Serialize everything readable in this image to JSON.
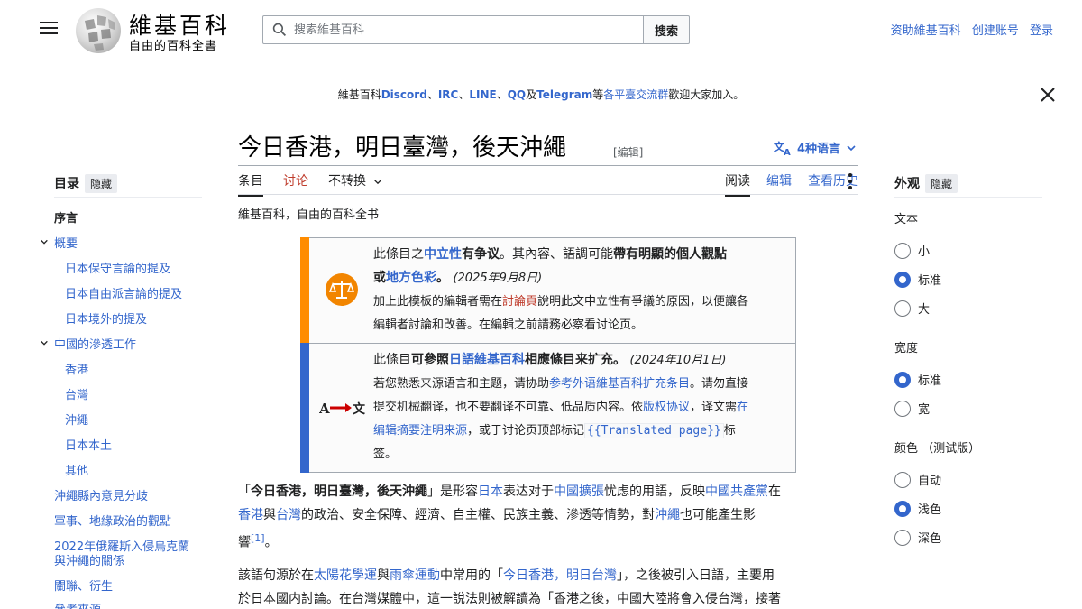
{
  "header": {
    "logo_title": "維基百科",
    "logo_tagline": "自由的百科全書",
    "search_placeholder": "搜索維基百科",
    "search_button": "搜索",
    "user_links": [
      "资助維基百科",
      "创建账号",
      "登录"
    ]
  },
  "sitenotice": {
    "prefix": "維基百科",
    "discord": "Discord",
    "sep1": "、",
    "irc": "IRC",
    "sep2": "、",
    "line": "LINE",
    "sep3": "、",
    "qq": "QQ",
    "mid": "及",
    "telegram": "Telegram",
    "pre_groups": "等",
    "groups": "各平臺交流群",
    "suffix": "歡迎大家加入。"
  },
  "article": {
    "title": "今日香港，明日臺灣，後天沖繩",
    "edit_label": "[编辑]",
    "lang_label": "4种语言",
    "tabs_left": [
      "条目",
      "讨论",
      "不转换"
    ],
    "tabs_right": [
      "阅读",
      "编辑",
      "查看历史"
    ],
    "from_wiki": "維基百科，自由的百科全书"
  },
  "toc": {
    "heading": "目录",
    "hide": "隐藏",
    "items": [
      {
        "label": "序言"
      },
      {
        "label": "概要"
      },
      {
        "label": "日本保守言論的提及"
      },
      {
        "label": "日本自由派言論的提及"
      },
      {
        "label": "日本境外的提及"
      },
      {
        "label": "中國的滲透工作"
      },
      {
        "label": "香港"
      },
      {
        "label": "台灣"
      },
      {
        "label": "沖繩"
      },
      {
        "label": "日本本土"
      },
      {
        "label": "其他"
      },
      {
        "label": "沖繩縣內意見分歧"
      },
      {
        "label": "軍事、地緣政治的觀點"
      },
      {
        "label": "2022年俄羅斯入侵烏克蘭"
      },
      {
        "label": "與沖繩的關係"
      },
      {
        "label": "關聯、衍生"
      },
      {
        "label": "參考來源"
      }
    ]
  },
  "appearance": {
    "heading": "外观",
    "hide": "隐藏",
    "text_label": "文本",
    "text_options": [
      "小",
      "标准",
      "大"
    ],
    "width_label": "宽度",
    "width_options": [
      "标准",
      "宽"
    ],
    "color_label": "颜色 （测试版）",
    "color_options": [
      "自动",
      "浅色",
      "深色"
    ]
  },
  "ambox1": {
    "l1a": "此條目之",
    "l1b": "中立性",
    "l1c": "有争议",
    "l1d": "。其內容、語調可能",
    "l1e": "帶有明顯的個人觀點",
    "l2a": "或",
    "l2b": "地方色彩",
    "l2c": "。",
    "date": "(2025年9月8日)",
    "l3a": "加上此模板的編輯者需在",
    "l3b": "討論頁",
    "l3c": "說明此文中立性有爭議的原因，以便讓各",
    "l4": "編輯者討論和改善。在編輯之前請務必察看讨论页。"
  },
  "ambox2": {
    "icon_text": "A→文",
    "l1a": "此條目",
    "l1b": "可參照",
    "l1c": "日語維基百科",
    "l1d": "相應條目",
    "l1e": "来扩充",
    "l1f": "。",
    "date": "(2024年10月1日)",
    "l2a": "若您熟悉来源语言和主题，请协助",
    "l2b": "参考外语維基百科扩充条目",
    "l2c": "。请勿直接",
    "l3a": "提交机械翻译，也不要翻译不可靠、低品质内容。依",
    "l3b": "版权协议",
    "l3c": "，译文需",
    "l3d": "在",
    "l4a": "编辑摘要注明来源",
    "l4b": "，或于讨论页顶部标记",
    "l4code": "{{Translated page}}",
    "l4c": "标",
    "l5": "签。"
  },
  "para1": {
    "q1": "「",
    "bold": "今日香港，明日臺灣，後天沖繩",
    "q2": "」是形容",
    "japan": "日本",
    "t1": "表达对于",
    "expansion": "中國擴張",
    "t2": "忧虑的用語，反映",
    "ccp": "中國共產黨",
    "t3": "在",
    "hk": "香港",
    "t4": "與",
    "tw": "台灣",
    "t5": "的政治、安全保障、經濟、自主權、民族主義、滲透等情勢，對",
    "okinawa": "沖繩",
    "t6": "也可能產生影",
    "t7": "響",
    "ref": "[1]",
    "t8": "。"
  },
  "para2": {
    "t1": "該語句源於在",
    "sunflower": "太陽花學運",
    "t2": "與",
    "umbrella": "雨傘運動",
    "t3": "中常用的「",
    "slogan": "今日香港，明日台灣",
    "t4": "」，之後被引入日語，主要用",
    "t5": "於日本國内討論。在台灣媒體中，這一說法則被解讀為「香港之後，中國大陸將會入侵台灣，接著"
  },
  "colors": {
    "link": "#3366cc",
    "neutrality_bar": "#ff8c00",
    "expand_bar": "#3366cc",
    "neutrality_icon": "#f28500"
  }
}
